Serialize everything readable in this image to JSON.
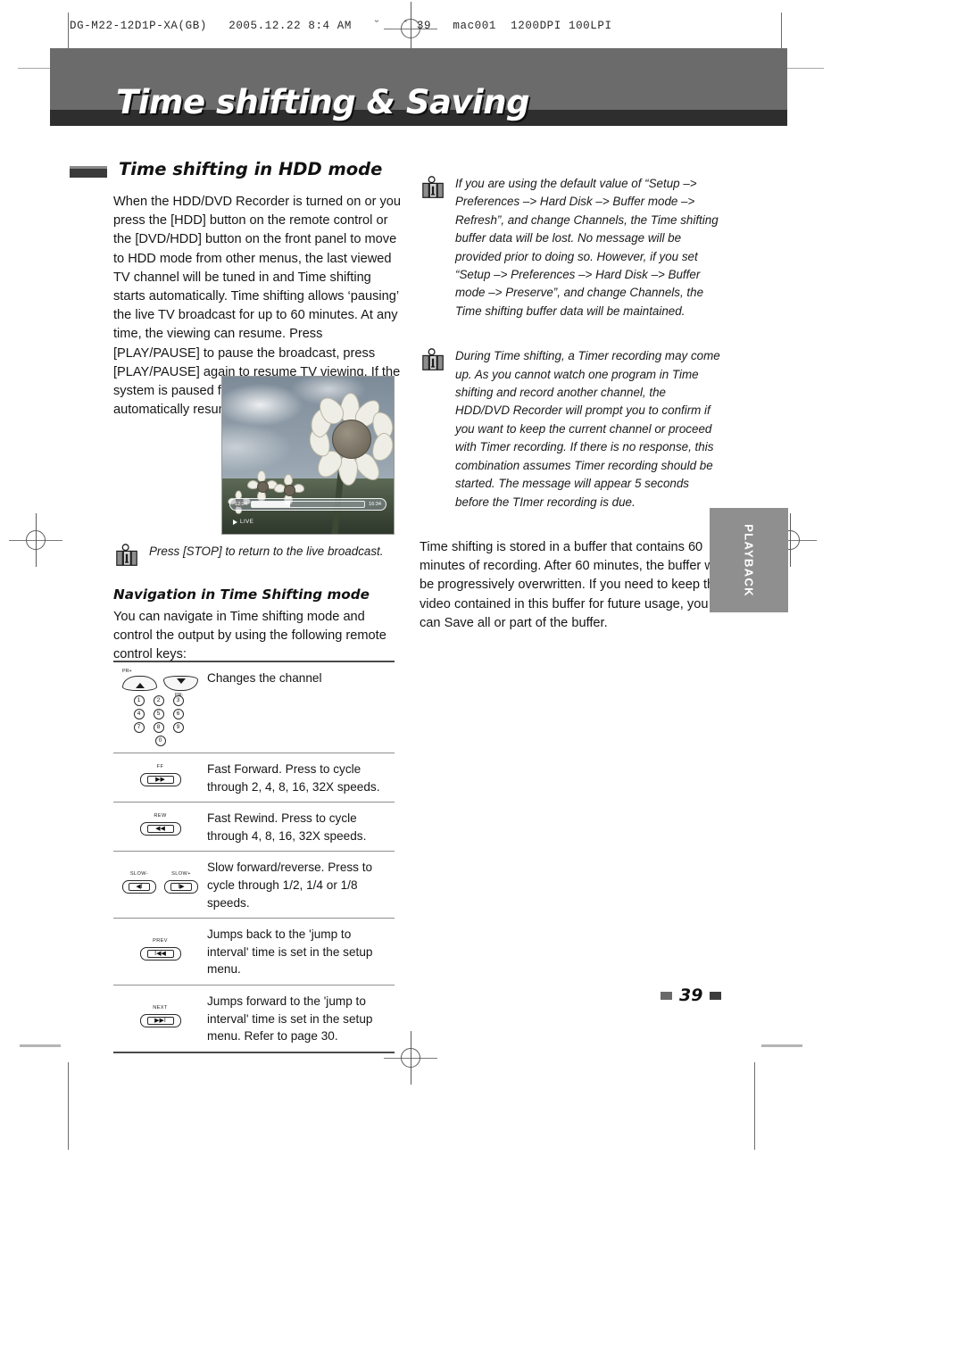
{
  "print_meta": "DG-M22-12D1P-XA(GB)   2005.12.22 8:4 AM   ˘   ` 39   mac001  1200DPI 100LPI",
  "banner": {
    "title": "Time shifting & Saving"
  },
  "section": {
    "title": "Time shifting in HDD mode"
  },
  "left_column": {
    "intro_paragraph": "When the HDD/DVD Recorder is turned on or you press the [HDD] button on the remote control or the [DVD/HDD] button on the front panel to move to HDD mode from other menus, the last viewed TV channel will be tuned in and Time shifting starts automatically. Time shifting allows ‘pausing’ the live TV broadcast for up to 60 minutes. At any time, the viewing can resume. Press [PLAY/PAUSE] to pause the broadcast, press [PLAY/PAUSE] again to resume TV viewing. If the system is paused for 60 minutes, it will automatically resume TV viewing."
  },
  "tv_screenshot": {
    "osd_time_left": "12:34",
    "osd_time_right": "16:34",
    "osd_status": "LIVE"
  },
  "caption_note": {
    "text": "Press [STOP] to return to the live broadcast."
  },
  "navigation": {
    "heading": "Navigation in Time Shifting mode",
    "paragraph": "You can navigate in Time shifting mode and control the output by using the following remote control keys:"
  },
  "key_table": {
    "rows": [
      {
        "icon": "channel-keys",
        "labels": {
          "up": "PR+",
          "down": "PR-"
        },
        "numbers": [
          "1",
          "2",
          "3",
          "4",
          "5",
          "6",
          "7",
          "8",
          "9",
          "0"
        ],
        "description": "Changes the channel"
      },
      {
        "icon": "fast-forward-button",
        "button_label": "FF",
        "glyph": "▶▶",
        "description": "Fast Forward. Press to cycle through 2, 4, 8, 16, 32X speeds."
      },
      {
        "icon": "rewind-button",
        "button_label": "REW",
        "glyph": "◀◀",
        "description": "Fast Rewind. Press to cycle through 4, 8, 16, 32X speeds."
      },
      {
        "icon": "slow-buttons",
        "button_label": "SLOW-",
        "button_label2": "SLOW+",
        "glyph": "◀Ι",
        "glyph2": "Ι▶",
        "description": "Slow forward/reverse. Press to cycle through 1/2, 1/4 or 1/8 speeds."
      },
      {
        "icon": "prev-button",
        "button_label": "PREV",
        "glyph": "Ι◀◀",
        "description": "Jumps back to the 'jump to interval' time is set in the setup menu."
      },
      {
        "icon": "next-button",
        "button_label": "NEXT",
        "glyph": "▶▶Ι",
        "description": "Jumps forward to the 'jump to interval' time is set in the setup menu. Refer to page 30."
      }
    ]
  },
  "right_column": {
    "note1": "If you are using the default value of “Setup –> Preferences –> Hard Disk  –> Buffer mode  –> Refresh”, and change Channels, the Time shifting buffer data will be lost. No message will be provided prior to doing so. However, if you set “Setup –> Preferences –> Hard Disk  –> Buffer mode  –> Preserve”, and change Channels, the Time shifting buffer data will be maintained.",
    "note2": "During Time shifting, a Timer recording may come up. As you cannot watch one program in Time shifting and record another channel, the HDD/DVD Recorder will prompt you to confirm if you want to keep the current channel or proceed with Timer recording. If there is no response, this combination assumes Timer recording should be started. The message will appear 5 seconds before the TImer recording is due.",
    "paragraph": "Time shifting is stored in a buffer that contains 60 minutes of recording. After 60 minutes, the buffer will be progressively overwritten. If you need to keep the video contained in this buffer for future usage, you can Save all or part of the buffer."
  },
  "side_tab": {
    "label": "PLAYBACK"
  },
  "page_number": "39",
  "colors": {
    "banner_gray": "#6b6b6b",
    "banner_dark": "#2e2e2e",
    "side_tab_gray": "#8f8f8f"
  }
}
